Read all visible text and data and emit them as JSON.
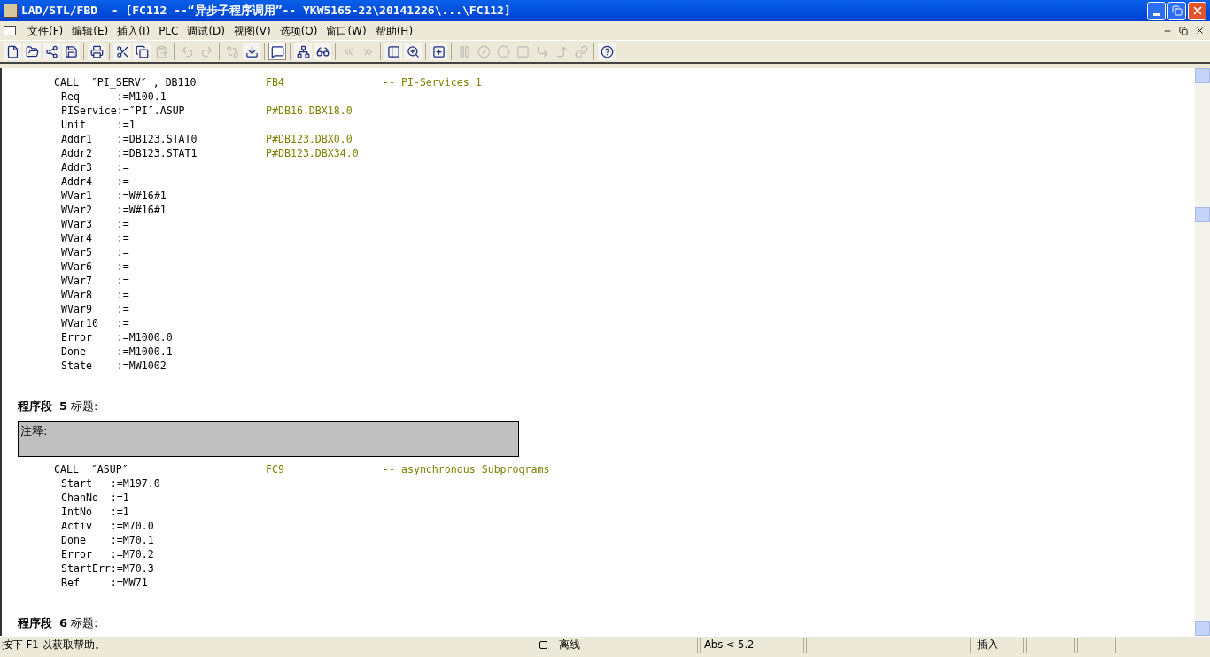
{
  "window": {
    "title": "LAD/STL/FBD  - [FC112 --“异步子程序调用”-- YKW5165-22\\20141226\\...\\FC112]"
  },
  "menu": [
    "文件(F)",
    "编辑(E)",
    "插入(I)",
    "PLC",
    "调试(D)",
    "视图(V)",
    "选项(O)",
    "窗口(W)",
    "帮助(H)"
  ],
  "toolbar": [
    {
      "kind": "new",
      "disabled": false
    },
    {
      "kind": "open",
      "disabled": false
    },
    {
      "kind": "accessible",
      "disabled": false
    },
    {
      "kind": "save",
      "disabled": false
    },
    {
      "kind": "sep"
    },
    {
      "kind": "print",
      "disabled": false
    },
    {
      "kind": "sep"
    },
    {
      "kind": "cut",
      "disabled": false
    },
    {
      "kind": "copy",
      "disabled": false
    },
    {
      "kind": "paste",
      "disabled": true
    },
    {
      "kind": "sep"
    },
    {
      "kind": "undo",
      "disabled": true
    },
    {
      "kind": "redo",
      "disabled": true
    },
    {
      "kind": "sep"
    },
    {
      "kind": "compare",
      "disabled": true
    },
    {
      "kind": "download",
      "disabled": false
    },
    {
      "kind": "sep"
    },
    {
      "kind": "overview",
      "disabled": false,
      "pressed": true
    },
    {
      "kind": "sep"
    },
    {
      "kind": "network",
      "disabled": false
    },
    {
      "kind": "monitor",
      "disabled": false
    },
    {
      "kind": "sep"
    },
    {
      "kind": "first",
      "disabled": true
    },
    {
      "kind": "last",
      "disabled": true
    },
    {
      "kind": "sep"
    },
    {
      "kind": "panel",
      "disabled": false
    },
    {
      "kind": "zoom",
      "disabled": false
    },
    {
      "kind": "sep"
    },
    {
      "kind": "newnet",
      "disabled": false
    },
    {
      "kind": "sep"
    },
    {
      "kind": "contact",
      "disabled": true
    },
    {
      "kind": "ncontact",
      "disabled": true
    },
    {
      "kind": "coil",
      "disabled": true
    },
    {
      "kind": "box",
      "disabled": true
    },
    {
      "kind": "branch",
      "disabled": true
    },
    {
      "kind": "close",
      "disabled": true
    },
    {
      "kind": "connect",
      "disabled": true
    },
    {
      "kind": "sep"
    },
    {
      "kind": "help",
      "disabled": false
    }
  ],
  "editor": [
    {
      "kind": "call",
      "text": "CALL  ″PI_SERV″ , DB110",
      "address": "FB4",
      "comment": "-- PI-Services 1"
    },
    {
      "kind": "param",
      "text": "Req      :=M100.1"
    },
    {
      "kind": "param",
      "text": "PIService:=″PI″.ASUP",
      "address": "P#DB16.DBX18.0"
    },
    {
      "kind": "param",
      "text": "Unit     :=1"
    },
    {
      "kind": "param",
      "text": "Addr1    :=DB123.STAT0",
      "address": "P#DB123.DBX0.0"
    },
    {
      "kind": "param",
      "text": "Addr2    :=DB123.STAT1",
      "address": "P#DB123.DBX34.0"
    },
    {
      "kind": "param",
      "text": "Addr3    :="
    },
    {
      "kind": "param",
      "text": "Addr4    :="
    },
    {
      "kind": "param",
      "text": "WVar1    :=W#16#1"
    },
    {
      "kind": "param",
      "text": "WVar2    :=W#16#1"
    },
    {
      "kind": "param",
      "text": "WVar3    :="
    },
    {
      "kind": "param",
      "text": "WVar4    :="
    },
    {
      "kind": "param",
      "text": "WVar5    :="
    },
    {
      "kind": "param",
      "text": "WVar6    :="
    },
    {
      "kind": "param",
      "text": "WVar7    :="
    },
    {
      "kind": "param",
      "text": "WVar8    :="
    },
    {
      "kind": "param",
      "text": "WVar9    :="
    },
    {
      "kind": "param",
      "text": "WVar10   :="
    },
    {
      "kind": "param",
      "text": "Error    :=M1000.0"
    },
    {
      "kind": "param",
      "text": "Done     :=M1000.1"
    },
    {
      "kind": "param",
      "text": "State    :=MW1002"
    },
    {
      "kind": "network",
      "label": "程序段",
      "number": "5",
      "title": "标题:"
    },
    {
      "kind": "remark",
      "text": "注释:"
    },
    {
      "kind": "call",
      "text": "CALL  ″ASUP″",
      "address": "FC9",
      "comment": "-- asynchronous Subprograms"
    },
    {
      "kind": "param",
      "text": "Start   :=M197.0"
    },
    {
      "kind": "param",
      "text": "ChanNo  :=1"
    },
    {
      "kind": "param",
      "text": "IntNo   :=1"
    },
    {
      "kind": "param",
      "text": "Activ   :=M70.0"
    },
    {
      "kind": "param",
      "text": "Done    :=M70.1"
    },
    {
      "kind": "param",
      "text": "Error   :=M70.2"
    },
    {
      "kind": "param",
      "text": "StartErr:=M70.3"
    },
    {
      "kind": "param",
      "text": "Ref     :=MW71"
    },
    {
      "kind": "network",
      "label": "程序段",
      "number": "6",
      "title": "标题:"
    }
  ],
  "status_bar": {
    "help": "按下 F1 以获取帮助。",
    "panels": [
      {
        "kind": "empty"
      },
      {
        "kind": "icon"
      },
      {
        "kind": "text",
        "text": "离线"
      },
      {
        "kind": "text",
        "text": "Abs < 5.2"
      },
      {
        "kind": "empty"
      },
      {
        "kind": "text",
        "text": "插入"
      },
      {
        "kind": "empty"
      },
      {
        "kind": "empty"
      }
    ]
  }
}
